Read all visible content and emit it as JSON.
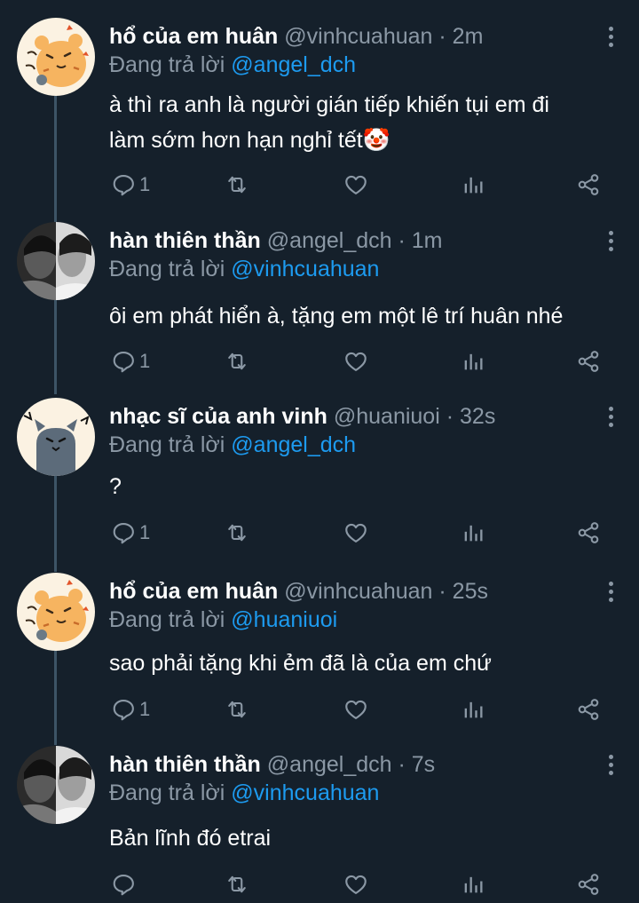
{
  "colors": {
    "background": "#15202b",
    "text": "#ffffff",
    "muted": "#8b98a5",
    "mention": "#1d9bf0",
    "thread_line": "#3d5466"
  },
  "icons": {
    "reply": "reply-bubble-icon",
    "retweet": "retweet-icon",
    "like": "heart-icon",
    "stats": "bar-chart-icon",
    "share": "share-icon",
    "more": "more-vertical-icon"
  },
  "tweets": [
    {
      "name": "hổ của em huân",
      "handle": "@vinhcuahuan",
      "separator": "·",
      "time": "2m",
      "reply_prefix": "Đang trả lời",
      "reply_to": "@angel_dch",
      "text_line1": "à thì ra anh là người gián tiếp khiến tụi em đi",
      "text_line2": "làm sớm hơn hạn nghỉ tết",
      "emoji": "🤡",
      "reply_count": "1",
      "avatar": "tiger-avatar"
    },
    {
      "name": "hàn thiên thần",
      "handle": "@angel_dch",
      "separator": "·",
      "time": "1m",
      "reply_prefix": "Đang trả lời",
      "reply_to": "@vinhcuahuan",
      "text": "ôi em phát hiển à, tặng em một lê trí huân nhé",
      "reply_count": "1",
      "avatar": "photo-avatar"
    },
    {
      "name": "nhạc sĩ của anh vinh",
      "handle": "@huaniuoi",
      "separator": "·",
      "time": "32s",
      "reply_prefix": "Đang trả lời",
      "reply_to": "@angel_dch",
      "text": "?",
      "reply_count": "1",
      "avatar": "cat-avatar"
    },
    {
      "name": "hổ của em huân",
      "handle": "@vinhcuahuan",
      "separator": "·",
      "time": "25s",
      "reply_prefix": "Đang trả lời",
      "reply_to": "@huaniuoi",
      "text": "sao phải tặng khi ẻm đã là của em chứ",
      "reply_count": "1",
      "avatar": "tiger-avatar"
    },
    {
      "name": "hàn thiên thần",
      "handle": "@angel_dch",
      "separator": "·",
      "time": "7s",
      "reply_prefix": "Đang trả lời",
      "reply_to": "@vinhcuahuan",
      "text": "Bản lĩnh đó etrai",
      "reply_count": "",
      "avatar": "photo-avatar"
    }
  ]
}
